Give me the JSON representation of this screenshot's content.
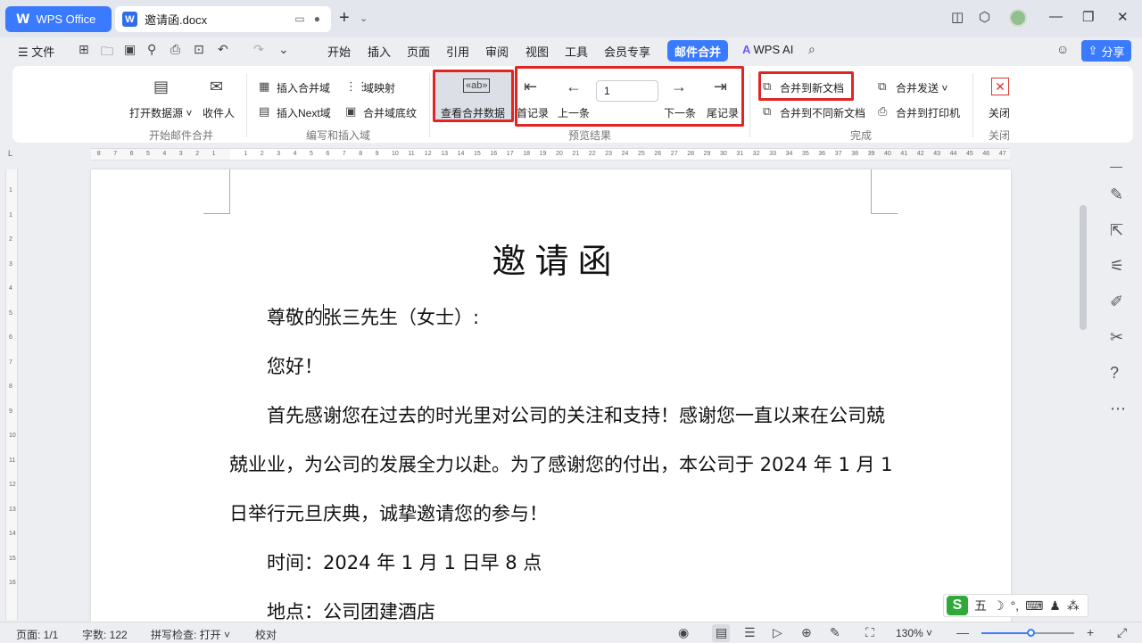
{
  "titlebar": {
    "app_tab": "WPS Office",
    "doc_tab": "邀请函.docx",
    "doc_tab_letter": "W"
  },
  "menubar": {
    "file": "文件",
    "tabs": [
      "开始",
      "插入",
      "页面",
      "引用",
      "审阅",
      "视图",
      "工具",
      "会员专享"
    ],
    "active_tab": "邮件合并",
    "wps_ai": "WPS AI",
    "share": "分享"
  },
  "ribbon": {
    "open_source": "打开数据源",
    "recipients": "收件人",
    "group_start": "开始邮件合并",
    "insert_field": "插入合并域",
    "field_map": "域映射",
    "insert_next": "插入Next域",
    "field_shading": "合并域底纹",
    "group_write": "编写和插入域",
    "view_data": "查看合并数据",
    "first_record": "首记录",
    "prev_record": "上一条",
    "record_number": "1",
    "next_record": "下一条",
    "last_record": "尾记录",
    "group_preview": "预览结果",
    "merge_new_doc": "合并到新文档",
    "merge_send": "合并发送",
    "merge_diff_docs": "合并到不同新文档",
    "merge_printer": "合并到打印机",
    "group_finish": "完成",
    "close": "关闭",
    "group_close": "关闭"
  },
  "ruler": {
    "left_ticks": [
      "8",
      "7",
      "6",
      "5",
      "4",
      "3",
      "2",
      "1"
    ],
    "right_ticks": [
      "1",
      "2",
      "3",
      "4",
      "5",
      "6",
      "7",
      "8",
      "9",
      "10",
      "11",
      "12",
      "13",
      "14",
      "15",
      "16",
      "17",
      "18",
      "19",
      "20",
      "21",
      "22",
      "23",
      "24",
      "25",
      "26",
      "27",
      "28",
      "29",
      "30",
      "31",
      "32",
      "33",
      "34",
      "35",
      "36",
      "37",
      "38",
      "39",
      "40",
      "41",
      "42",
      "43",
      "44",
      "45",
      "46",
      "47"
    ],
    "vertical_ticks": [
      "1",
      "1",
      "2",
      "3",
      "4",
      "5",
      "6",
      "7",
      "8",
      "9",
      "10",
      "11",
      "12",
      "13",
      "14",
      "15",
      "16"
    ]
  },
  "document": {
    "title": "邀请函",
    "salutation": "尊敬的张三先生（女士）:",
    "greeting": "您好！",
    "para1_line1": "首先感谢您在过去的时光里对公司的关注和支持！感谢您一直以来在公司兢",
    "para1_line2": "兢业业，为公司的发展全力以赴。为了感谢您的付出，本公司于 2024 年 1 月 1",
    "para1_line3": "日举行元旦庆典，诚挚邀请您的参与！",
    "time": "时间：2024 年 1 月 1 日早 8 点",
    "place": "地点：公司团建酒店"
  },
  "statusbar": {
    "page": "页面: 1/1",
    "words": "字数: 122",
    "spellcheck": "拼写检查: 打开",
    "proofread": "校对",
    "zoom": "130%",
    "zoom_level_percent": 54
  },
  "ime": {
    "logo": "S",
    "mode": "五"
  },
  "colors": {
    "accent": "#3a7afe",
    "highlight": "#e12424"
  }
}
